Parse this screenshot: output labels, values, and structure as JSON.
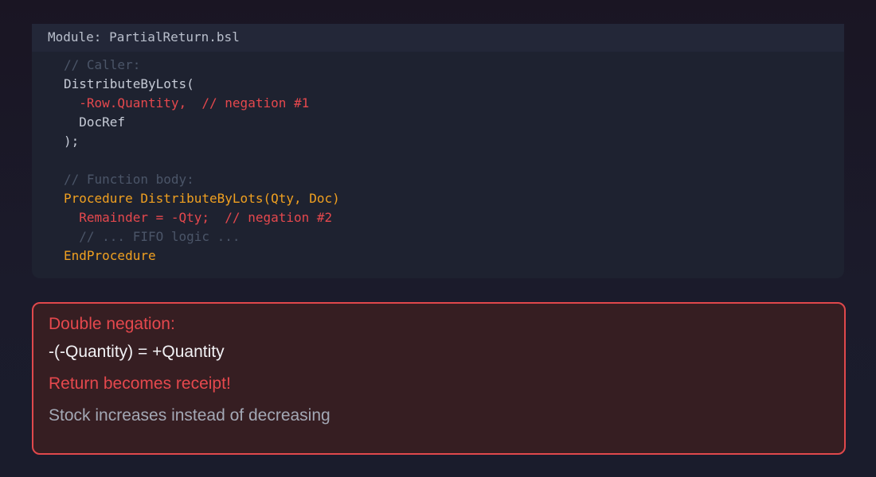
{
  "code_panel": {
    "module_label": "Module: PartialReturn.bsl",
    "lines": [
      {
        "text": "// Caller:",
        "style": "comment"
      },
      {
        "text": "DistributeByLots(",
        "style": "default"
      },
      {
        "text": "  -Row.Quantity,  // negation #1",
        "style": "red"
      },
      {
        "text": "  DocRef",
        "style": "default"
      },
      {
        "text": ");",
        "style": "default"
      },
      {
        "text": "",
        "style": "blank"
      },
      {
        "text": "// Function body:",
        "style": "comment"
      },
      {
        "text": "Procedure DistributeByLots(Qty, Doc)",
        "style": "orange"
      },
      {
        "text": "  Remainder = -Qty;  // negation #2",
        "style": "red"
      },
      {
        "text": "  // ... FIFO logic ...",
        "style": "comment"
      },
      {
        "text": "EndProcedure",
        "style": "orange"
      }
    ]
  },
  "alert": {
    "title": "Double negation:",
    "formula": "-(-Quantity) = +Quantity",
    "warning": "Return becomes receipt!",
    "detail": "Stock increases instead of decreasing"
  },
  "colors": {
    "comment": "#4b5568",
    "default": "#c6cbd6",
    "red": "#e5484d",
    "orange": "#f0a020",
    "alert_border": "#e0484c",
    "alert_bg": "#361e22"
  }
}
